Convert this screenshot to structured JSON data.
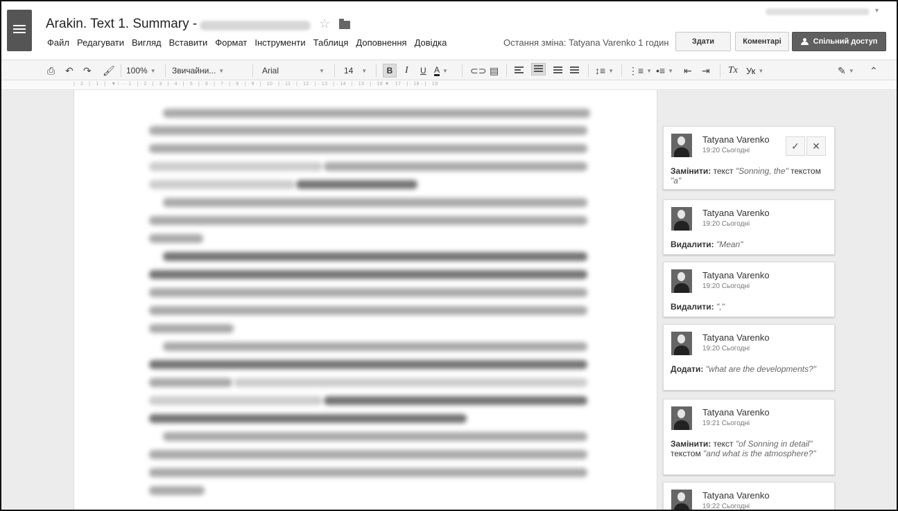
{
  "header": {
    "title": "Arakin. Text 1. Summary -",
    "menu": [
      "Файл",
      "Редагувати",
      "Вигляд",
      "Вставити",
      "Формат",
      "Інструменти",
      "Таблиця",
      "Доповнення",
      "Довідка"
    ],
    "last_edit": "Остання зміна: Tatyana Varenko 1 годин",
    "submit_label": "Здати",
    "comments_label": "Коментарі",
    "share_label": "Спільний доступ"
  },
  "toolbar": {
    "zoom": "100%",
    "style": "Звичайни...",
    "font": "Arial",
    "size": "14",
    "bold": "B",
    "italic": "I",
    "underline": "U",
    "text_color": "A",
    "language": "Ук",
    "clear_format": "Tx"
  },
  "ruler": {
    "marks": "| · 2 · | · 1 · | · ▼ ʲ ··· 1 · | · 2 · | · 3 · | · 4 · | · 5 · | · 6 · | · 7 · | · 8 · | · 9 · | · 10 · | · 11 · | · 12 · | · 13 · | · 14 · | · 15 · | · 16 ▼ · 17 · | · 18 · | · 19"
  },
  "comments": [
    {
      "author": "Tatyana Varenko",
      "time": "19:20 Сьогодні",
      "action": "Замінити:",
      "text1": " текст ",
      "quote1": "\"Sonning, the\"",
      "text2": " текстом ",
      "quote2": "\"a\""
    },
    {
      "author": "Tatyana Varenko",
      "time": "19:20 Сьогодні",
      "action": "Видалити:",
      "quote1": "\"Mean\""
    },
    {
      "author": "Tatyana Varenko",
      "time": "19:20 Сьогодні",
      "action": "Видалити:",
      "quote1": "\",\""
    },
    {
      "author": "Tatyana Varenko",
      "time": "19:20 Сьогодні",
      "action": "Додати:",
      "quote1": "\"what are the developments?\""
    },
    {
      "author": "Tatyana Varenko",
      "time": "19:21 Сьогодні",
      "action": "Замінити:",
      "text1": " текст ",
      "quote1": "\"of Sonning in detail\"",
      "text2": " текстом ",
      "quote2": "\"and what is the atmosphere?\""
    },
    {
      "author": "Tatyana Varenko",
      "time": "19:22 Сьогодні"
    }
  ],
  "colors": {
    "share_button": "#5f5f5f",
    "toolbar_bg": "#f5f5f5",
    "doc_bg": "#ececec"
  }
}
